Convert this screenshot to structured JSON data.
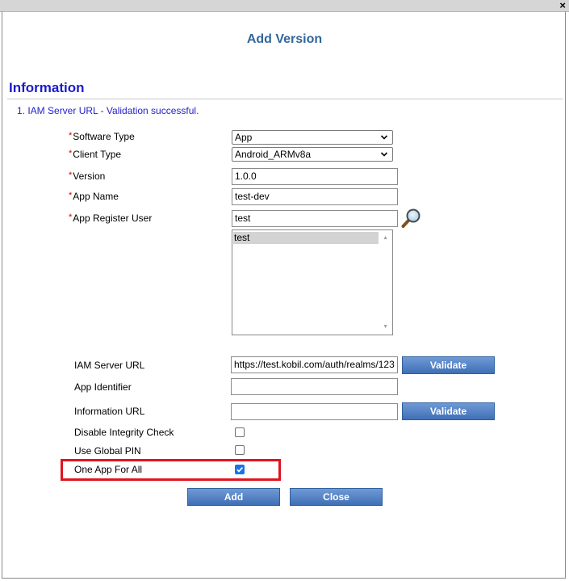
{
  "dialog": {
    "title": "Add Version",
    "close_glyph": "×"
  },
  "section": {
    "title": "Information",
    "status_message": "1. IAM Server URL - Validation successful."
  },
  "form": {
    "required_marker": "*",
    "software_type": {
      "label": "Software Type",
      "value": "App"
    },
    "client_type": {
      "label": "Client Type",
      "value": "Android_ARMv8a"
    },
    "version": {
      "label": "Version",
      "value": "1.0.0"
    },
    "app_name": {
      "label": "App Name",
      "value": "test-dev"
    },
    "app_register_user": {
      "label": "App Register User",
      "value": "test",
      "list_items": [
        "test"
      ]
    },
    "iam_server_url": {
      "label": "IAM Server URL",
      "value": "https://test.kobil.com/auth/realms/123",
      "validate_label": "Validate"
    },
    "app_identifier": {
      "label": "App Identifier",
      "value": ""
    },
    "information_url": {
      "label": "Information URL",
      "value": "",
      "validate_label": "Validate"
    },
    "disable_integrity_check": {
      "label": "Disable Integrity Check",
      "checked": false
    },
    "use_global_pin": {
      "label": "Use Global PIN",
      "checked": false
    },
    "one_app_for_all": {
      "label": "One App For All",
      "checked": true
    }
  },
  "actions": {
    "add_label": "Add",
    "close_label": "Close"
  },
  "icons": {
    "search": "magnifier-icon",
    "dropdown": "chevron-down-icon",
    "check": "checkmark-icon"
  },
  "colors": {
    "title": "#336699",
    "section_title": "#1a1acc",
    "status": "#2222cc",
    "button": "#4a78be",
    "highlight": "#e0141e",
    "checked": "#1a73e8"
  }
}
